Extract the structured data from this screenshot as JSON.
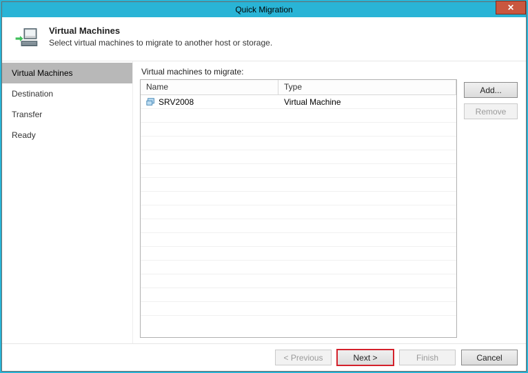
{
  "titlebar": {
    "title": "Quick Migration"
  },
  "header": {
    "title": "Virtual Machines",
    "subtitle": "Select virtual machines to migrate to another host or storage."
  },
  "sidebar": {
    "items": [
      {
        "label": "Virtual Machines",
        "active": true
      },
      {
        "label": "Destination",
        "active": false
      },
      {
        "label": "Transfer",
        "active": false
      },
      {
        "label": "Ready",
        "active": false
      }
    ]
  },
  "content": {
    "listLabel": "Virtual machines to migrate:",
    "columns": {
      "name": "Name",
      "type": "Type"
    },
    "rows": [
      {
        "name": "SRV2008",
        "type": "Virtual Machine"
      }
    ],
    "buttons": {
      "add": "Add...",
      "remove": "Remove"
    }
  },
  "footer": {
    "previous": "< Previous",
    "next": "Next >",
    "finish": "Finish",
    "cancel": "Cancel"
  }
}
